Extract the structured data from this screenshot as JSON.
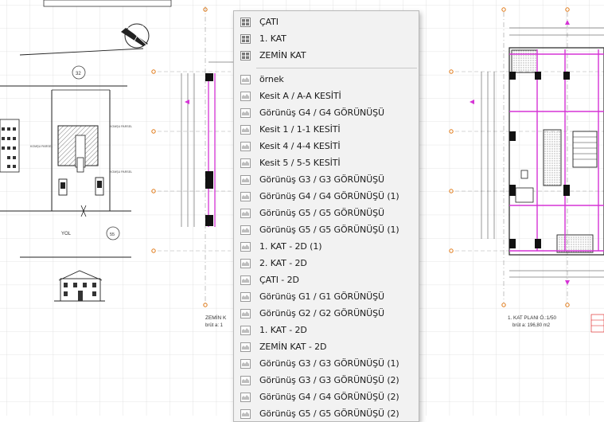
{
  "drawing": {
    "labels": {
      "north_circle": "32",
      "road": "YOL",
      "zone_circle": "55",
      "left_plan_title": "ZEMİN K",
      "left_plan_area": "brüt a: 1",
      "right_plan_title": "1. KAT PLANI Ö.:1/50",
      "right_plan_area": "brüt a: 196,80 m2",
      "parcel_note_a": "KOMŞU PARSEL",
      "parcel_note_b": "KOMŞU PARSEL",
      "parcel_note_c": "KOMŞU PARSEL"
    },
    "colors": {
      "wall_magenta": "#d633d6",
      "grid": "#dcdcdc",
      "line": "#1a1a1a",
      "marker": "#e07a18"
    }
  },
  "context_menu": {
    "story_items": [
      {
        "label": "ÇATI",
        "icon": "story-icon"
      },
      {
        "label": "1. KAT",
        "icon": "story-icon"
      },
      {
        "label": "ZEMİN KAT",
        "icon": "story-icon"
      }
    ],
    "view_items": [
      {
        "label": "örnek",
        "icon": "view-icon"
      },
      {
        "label": "Kesit A / A-A KESİTİ",
        "icon": "view-icon"
      },
      {
        "label": "Görünüş G4 / G4 GÖRÜNÜŞÜ",
        "icon": "view-icon"
      },
      {
        "label": "Kesit 1 / 1-1 KESİTİ",
        "icon": "view-icon"
      },
      {
        "label": "Kesit 4 / 4-4 KESİTİ",
        "icon": "view-icon"
      },
      {
        "label": "Kesit 5 / 5-5 KESİTİ",
        "icon": "view-icon"
      },
      {
        "label": "Görünüş G3 / G3 GÖRÜNÜŞÜ",
        "icon": "view-icon"
      },
      {
        "label": "Görünüş G4 / G4 GÖRÜNÜŞÜ (1)",
        "icon": "view-icon"
      },
      {
        "label": "Görünüş G5 / G5 GÖRÜNÜŞÜ",
        "icon": "view-icon"
      },
      {
        "label": "Görünüş G5 / G5 GÖRÜNÜŞÜ (1)",
        "icon": "view-icon"
      },
      {
        "label": "1. KAT - 2D (1)",
        "icon": "view-icon"
      },
      {
        "label": "2. KAT - 2D",
        "icon": "view-icon"
      },
      {
        "label": "ÇATI - 2D",
        "icon": "view-icon"
      },
      {
        "label": "Görünüş G1 / G1 GÖRÜNÜŞÜ",
        "icon": "view-icon"
      },
      {
        "label": "Görünüş G2 / G2 GÖRÜNÜŞÜ",
        "icon": "view-icon"
      },
      {
        "label": "1. KAT - 2D",
        "icon": "view-icon"
      },
      {
        "label": "ZEMİN KAT - 2D",
        "icon": "view-icon"
      },
      {
        "label": "Görünüş G3 / G3 GÖRÜNÜŞÜ (1)",
        "icon": "view-icon"
      },
      {
        "label": "Görünüş G3 / G3 GÖRÜNÜŞÜ (2)",
        "icon": "view-icon"
      },
      {
        "label": "Görünüş G4 / G4 GÖRÜNÜŞÜ (2)",
        "icon": "view-icon"
      },
      {
        "label": "Görünüş G5 / G5 GÖRÜNÜŞÜ (2)",
        "icon": "view-icon"
      }
    ]
  }
}
